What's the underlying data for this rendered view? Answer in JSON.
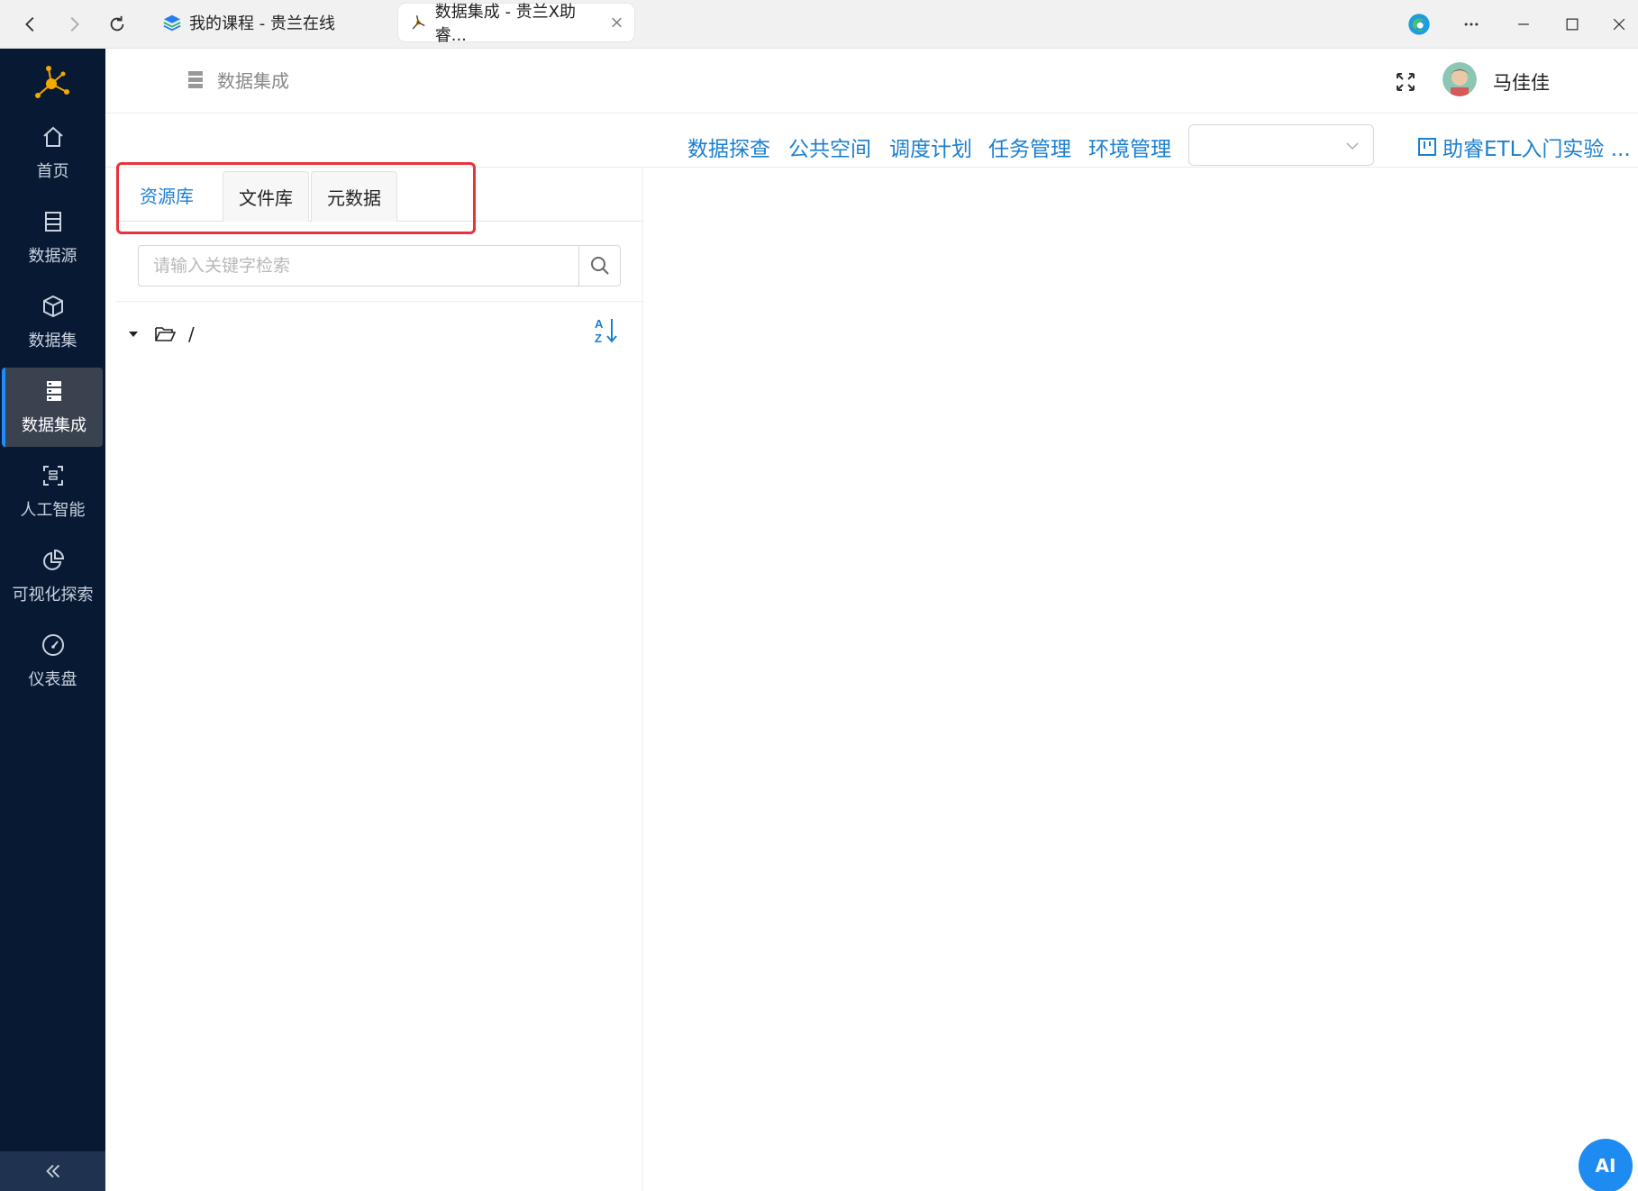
{
  "browser": {
    "tabs": [
      {
        "title": "我的课程 - 贵兰在线"
      },
      {
        "title": "数据集成 - 贵兰X助睿..."
      }
    ]
  },
  "sidebar": {
    "items": [
      {
        "label": "首页",
        "icon": "home-icon"
      },
      {
        "label": "数据源",
        "icon": "database-icon"
      },
      {
        "label": "数据集",
        "icon": "cube-icon"
      },
      {
        "label": "数据集成",
        "icon": "server-stack-icon",
        "active": true
      },
      {
        "label": "人工智能",
        "icon": "ai-scan-icon"
      },
      {
        "label": "可视化探索",
        "icon": "pie-chart-icon"
      },
      {
        "label": "仪表盘",
        "icon": "gauge-icon"
      }
    ]
  },
  "header": {
    "title": "数据集成",
    "user_name": "马佳佳"
  },
  "toolbar": {
    "links": [
      "数据探查",
      "公共空间",
      "调度计划",
      "任务管理",
      "环境管理"
    ],
    "select_value": "",
    "project_label": "助睿ETL入门实验 ..."
  },
  "panel": {
    "tabs": [
      "资源库",
      "文件库",
      "元数据"
    ],
    "active_tab": "资源库",
    "search_placeholder": "请输入关键字检索",
    "tree_root": "/"
  },
  "ai_button": "AI",
  "colors": {
    "accent": "#1b7fd1",
    "sidebar_bg": "#081a33",
    "highlight": "#e8333d"
  }
}
